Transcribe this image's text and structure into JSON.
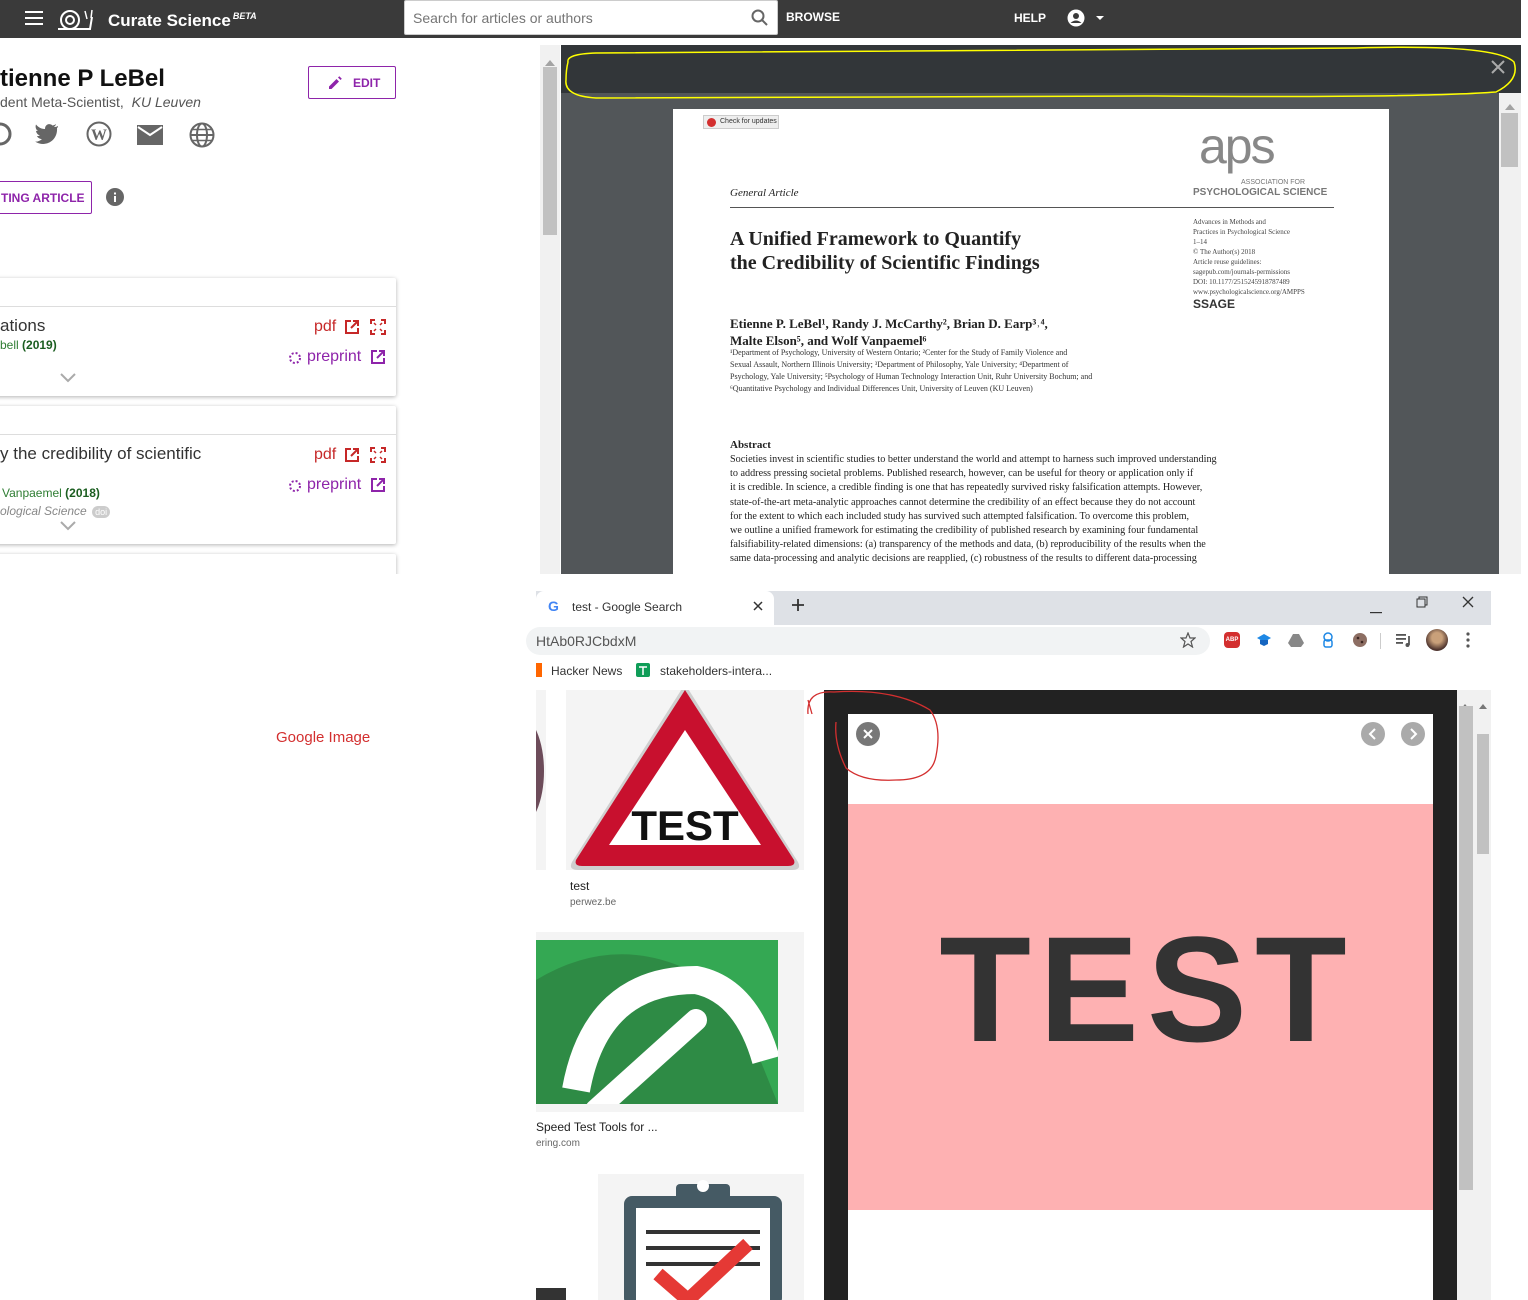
{
  "appbar": {
    "brand": "Curate Science",
    "brand_sup": "BETA",
    "search_placeholder": "Search for articles or authors",
    "browse_label": "BROWSE",
    "help_label": "HELP"
  },
  "profile": {
    "name": "tienne P LeBel",
    "position": "dent Meta-Scientist,",
    "affiliation": "KU Leuven",
    "edit_label": "EDIT",
    "add_article_label": "TING ARTICLE",
    "social_icons": [
      "orcid-icon",
      "twitter-icon",
      "wordpress-icon",
      "email-icon",
      "globe-icon"
    ]
  },
  "articles": [
    {
      "title": "ations",
      "authors": "bell",
      "year": "(2019)",
      "pdf_label": "pdf",
      "preprint_label": "preprint"
    },
    {
      "title": "y the credibility of scientific",
      "authors": "Vanpaemel",
      "year": "(2018)",
      "journal": "ological Science",
      "doi_badge": "doi",
      "pdf_label": "pdf",
      "preprint_label": "preprint"
    }
  ],
  "pdf_doc": {
    "check_updates": "Check for updates",
    "aps_logo": "aps",
    "aps_sub1": "ASSOCIATION FOR",
    "aps_sub2": "PSYCHOLOGICAL SCIENCE",
    "section": "General Article",
    "title_line1": "A Unified Framework to Quantify",
    "title_line2": "the Credibility of Scientific Findings",
    "meta": [
      "Advances in Methods and",
      "Practices in Psychological Science",
      "1–14",
      "© The Author(s) 2018",
      "Article reuse guidelines:",
      "sagepub.com/journals-permissions",
      "DOI: 10.1177/2515245918787489",
      "www.psychologicalscience.org/AMPPS"
    ],
    "sage": "SSAGE",
    "authors_line1": "Etienne P. LeBel¹, Randy J. McCarthy², Brian D. Earp³˒⁴,",
    "authors_line2": "Malte Elson⁵, and Wolf Vanpaemel⁶",
    "affiliations": [
      "¹Department of Psychology, University of Western Ontario; ²Center for the Study of Family Violence and",
      "Sexual Assault, Northern Illinois University; ³Department of Philosophy, Yale University; ⁴Department of",
      "Psychology, Yale University; ⁵Psychology of Human Technology Interaction Unit, Ruhr University Bochum; and",
      "⁶Quantitative Psychology and Individual Differences Unit, University of Leuven (KU Leuven)"
    ],
    "abstract_heading": "Abstract",
    "abstract_lines": [
      "Societies invest in scientific studies to better understand the world and attempt to harness such improved understanding",
      "to address pressing societal problems. Published research, however, can be useful for theory or application only if",
      "it is credible. In science, a credible finding is one that has repeatedly survived risky falsification attempts. However,",
      "state-of-the-art meta-analytic approaches cannot determine the credibility of an effect because they do not account",
      "for the extent to which each included study has survived such attempted falsification. To overcome this problem,",
      "we outline a unified framework for estimating the credibility of published research by examining four fundamental",
      "falsifiability-related dimensions: (a) transparency of the methods and data, (b) reproducibility of the results when the",
      "same data-processing and analytic decisions are reapplied, (c) robustness of the results to different data-processing"
    ]
  },
  "annotation": {
    "label": "Google Image",
    "highlight_color": "#ffff00",
    "circle_color": "#d32f2f"
  },
  "chrome": {
    "tab_title": "test - Google Search",
    "url_partial": "HtAb0RJCbdxM",
    "bookmarks": [
      "Hacker News",
      "stakeholders-intera..."
    ],
    "extension_abp": "ABP"
  },
  "results": [
    {
      "title": "test",
      "source": "perwez.be"
    },
    {
      "title": "Speed Test Tools for ...",
      "source": "ering.com"
    }
  ],
  "preview": {
    "image_text": "TEST",
    "bg_color": "#feb1b2"
  },
  "sign_text": "TEST"
}
